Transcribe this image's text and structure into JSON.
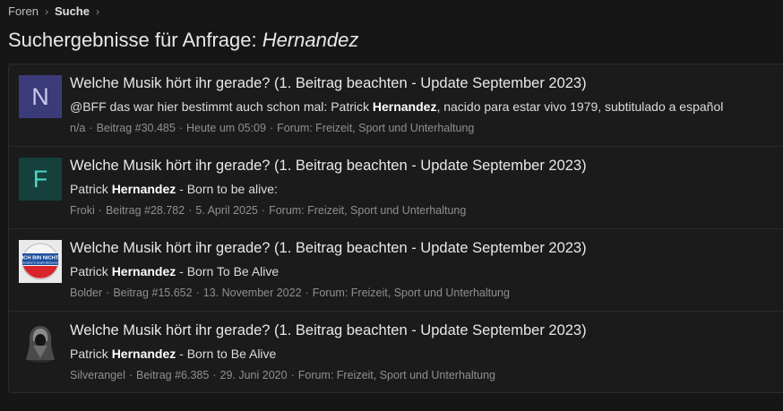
{
  "breadcrumb": {
    "items": [
      "Foren",
      "Suche"
    ],
    "separator": "›"
  },
  "page": {
    "title_prefix": "Suchergebnisse für Anfrage: ",
    "query": "Hernandez"
  },
  "results": [
    {
      "avatar": {
        "type": "letter",
        "letter": "N",
        "bg": "#3b3b7a",
        "fg": "#c9c9f0"
      },
      "title": "Welche Musik hört ihr gerade? (1. Beitrag beachten - Update September 2023)",
      "snippet_pre": "@BFF das war hier bestimmt auch schon mal: Patrick ",
      "snippet_highlight": "Hernandez",
      "snippet_post": ", nacido para estar vivo 1979, subtitulado a español",
      "author": "n/a",
      "post": "Beitrag #30.485",
      "date": "Heute um 05:09",
      "forum": "Forum: Freizeit, Sport und Unterhaltung"
    },
    {
      "avatar": {
        "type": "letter",
        "letter": "F",
        "bg": "#15403c",
        "fg": "#4fd6c4"
      },
      "title": "Welche Musik hört ihr gerade? (1. Beitrag beachten - Update September 2023)",
      "snippet_pre": "Patrick ",
      "snippet_highlight": "Hernandez",
      "snippet_post": " - Born to be alive:",
      "author": "Froki",
      "post": "Beitrag #28.782",
      "date": "5. April 2025",
      "forum": "Forum: Freizeit, Sport und Unterhaltung"
    },
    {
      "avatar": {
        "type": "image",
        "icon": "flag-badge-icon",
        "badge_text": "ICH BIN NICHT",
        "badge_sub": "IM BESITZ EINER MEINUNG"
      },
      "title": "Welche Musik hört ihr gerade? (1. Beitrag beachten - Update September 2023)",
      "snippet_pre": "Patrick ",
      "snippet_highlight": "Hernandez",
      "snippet_post": " - Born To Be Alive",
      "author": "Bolder",
      "post": "Beitrag #15.652",
      "date": "13. November 2022",
      "forum": "Forum: Freizeit, Sport und Unterhaltung"
    },
    {
      "avatar": {
        "type": "image",
        "icon": "hooded-figure-icon"
      },
      "title": "Welche Musik hört ihr gerade? (1. Beitrag beachten - Update September 2023)",
      "snippet_pre": "Patrick ",
      "snippet_highlight": "Hernandez",
      "snippet_post": " - Born to Be Alive",
      "author": "Silverangel",
      "post": "Beitrag #6.385",
      "date": "29. Juni 2020",
      "forum": "Forum: Freizeit, Sport und Unterhaltung"
    }
  ],
  "meta_separator": "·"
}
